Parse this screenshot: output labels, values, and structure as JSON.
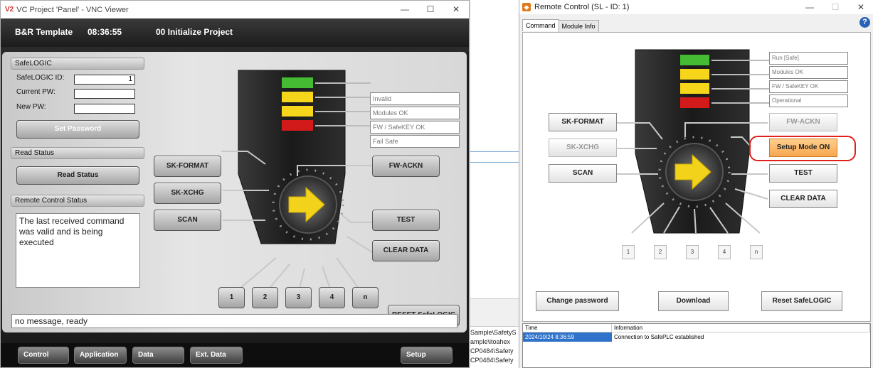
{
  "vnc": {
    "title": "VC Project 'Panel' - VNC Viewer",
    "logo": "V2",
    "header": {
      "template": "B&R Template",
      "time": "08:36:55",
      "project": "00 Initialize Project"
    },
    "safelogic": {
      "group": "SafeLOGIC",
      "id_label": "SafeLOGIC ID:",
      "id_value": "1",
      "current_pw_label": "Current PW:",
      "new_pw_label": "New PW:",
      "set_password": "Set Password"
    },
    "read_status": {
      "group": "Read Status",
      "button": "Read Status"
    },
    "remote_status": {
      "group": "Remote Control Status",
      "text": "The last received command was valid and is being executed"
    },
    "indicators": [
      "Invalid",
      "Modules OK",
      "FW / SafeKEY OK",
      "Fail Safe"
    ],
    "buttons": {
      "sk_format": "SK-FORMAT",
      "sk_xchg": "SK-XCHG",
      "scan": "SCAN",
      "fw_ackn": "FW-ACKN",
      "test": "TEST",
      "clear_data": "CLEAR DATA",
      "reset": "RESET SafeLOGIC"
    },
    "numbers": [
      "1",
      "2",
      "3",
      "4",
      "n"
    ],
    "message": "no message, ready",
    "nav": [
      "Control",
      "Application",
      "Data",
      "Ext. Data",
      "Setup"
    ]
  },
  "rc": {
    "title": "Remote Control (SL - ID: 1)",
    "tabs": [
      "Command",
      "Module Info"
    ],
    "help": "?",
    "indicators": [
      "Run [Safe]",
      "Modules OK",
      "FW / SafeKEY OK",
      "Operational"
    ],
    "buttons": {
      "sk_format": "SK-FORMAT",
      "sk_xchg": "SK-XCHG",
      "scan": "SCAN",
      "fw_ackn": "FW-ACKN",
      "setup_mode": "Setup Mode ON",
      "test": "TEST",
      "clear_data": "CLEAR DATA",
      "change_password": "Change password",
      "download": "Download",
      "reset": "Reset SafeLOGIC"
    },
    "numbers": [
      "1",
      "2",
      "3",
      "4",
      "n"
    ],
    "log": {
      "columns": [
        "Time",
        "Information"
      ],
      "rows": [
        {
          "time": "2024/10/24 8:36:59",
          "info": "Connection to SafePLC established"
        }
      ]
    }
  },
  "background": {
    "paths": [
      "Sample\\SafetyS",
      "ample\\itoahex",
      "CP0484\\Safety",
      "CP0484\\Safety"
    ]
  }
}
